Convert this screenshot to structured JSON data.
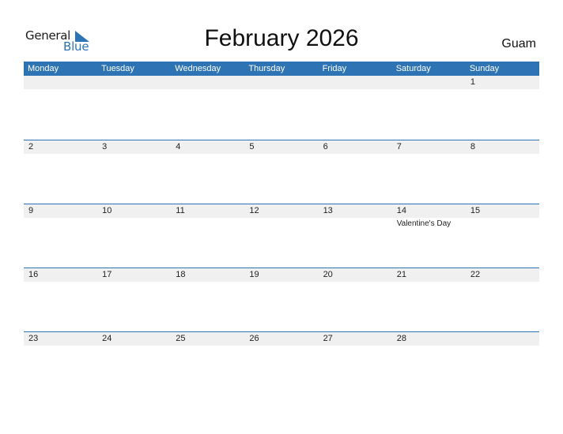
{
  "logo": {
    "general": "General",
    "blue": "Blue",
    "icon": "triangle-logo-icon",
    "accent": "#2e74b5"
  },
  "title": "February 2026",
  "region": "Guam",
  "weekdays": [
    "Monday",
    "Tuesday",
    "Wednesday",
    "Thursday",
    "Friday",
    "Saturday",
    "Sunday"
  ],
  "weeks": [
    {
      "days": [
        "",
        "",
        "",
        "",
        "",
        "",
        "1"
      ],
      "events": [
        "",
        "",
        "",
        "",
        "",
        "",
        ""
      ]
    },
    {
      "days": [
        "2",
        "3",
        "4",
        "5",
        "6",
        "7",
        "8"
      ],
      "events": [
        "",
        "",
        "",
        "",
        "",
        "",
        ""
      ]
    },
    {
      "days": [
        "9",
        "10",
        "11",
        "12",
        "13",
        "14",
        "15"
      ],
      "events": [
        "",
        "",
        "",
        "",
        "",
        "Valentine's Day",
        ""
      ]
    },
    {
      "days": [
        "16",
        "17",
        "18",
        "19",
        "20",
        "21",
        "22"
      ],
      "events": [
        "",
        "",
        "",
        "",
        "",
        "",
        ""
      ]
    },
    {
      "days": [
        "23",
        "24",
        "25",
        "26",
        "27",
        "28",
        ""
      ],
      "events": [
        "",
        "",
        "",
        "",
        "",
        "",
        ""
      ]
    }
  ]
}
